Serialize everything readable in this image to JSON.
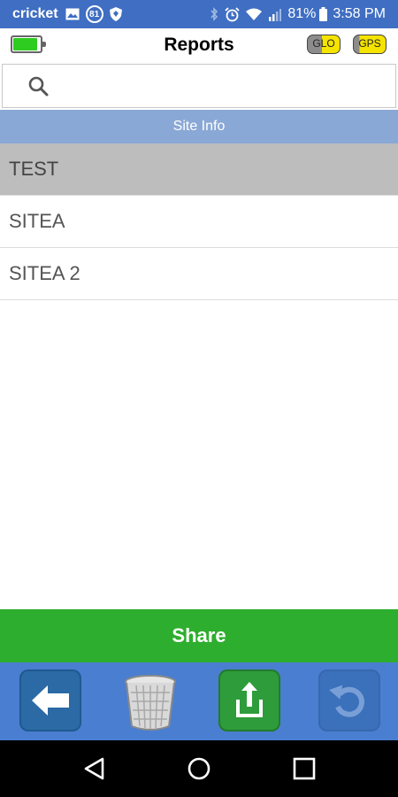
{
  "status_bar": {
    "carrier": "cricket",
    "notification_badge": "81",
    "battery_percent": "81%",
    "time": "3:58 PM"
  },
  "header": {
    "title": "Reports",
    "battery_level": 0.9,
    "glo_label": "GLO",
    "gps_label": "GPS"
  },
  "search": {
    "placeholder": "",
    "value": ""
  },
  "section": {
    "header": "Site Info"
  },
  "sites": [
    {
      "name": "TEST",
      "selected": true
    },
    {
      "name": "SITEA",
      "selected": false
    },
    {
      "name": "SITEA 2",
      "selected": false
    }
  ],
  "share_button": {
    "label": "Share"
  },
  "toolbar": {
    "items": [
      "back-arrow-icon",
      "trash-icon",
      "share-upload-icon",
      "undo-icon"
    ]
  },
  "nav": {
    "items": [
      "back-triangle-icon",
      "home-circle-icon",
      "recents-square-icon"
    ]
  },
  "colors": {
    "status_bar": "#3f6ec2",
    "section_header": "#8aa8d6",
    "share": "#2eae2e",
    "toolbar": "#4a7ed0",
    "selected_row": "#bdbdbd"
  }
}
